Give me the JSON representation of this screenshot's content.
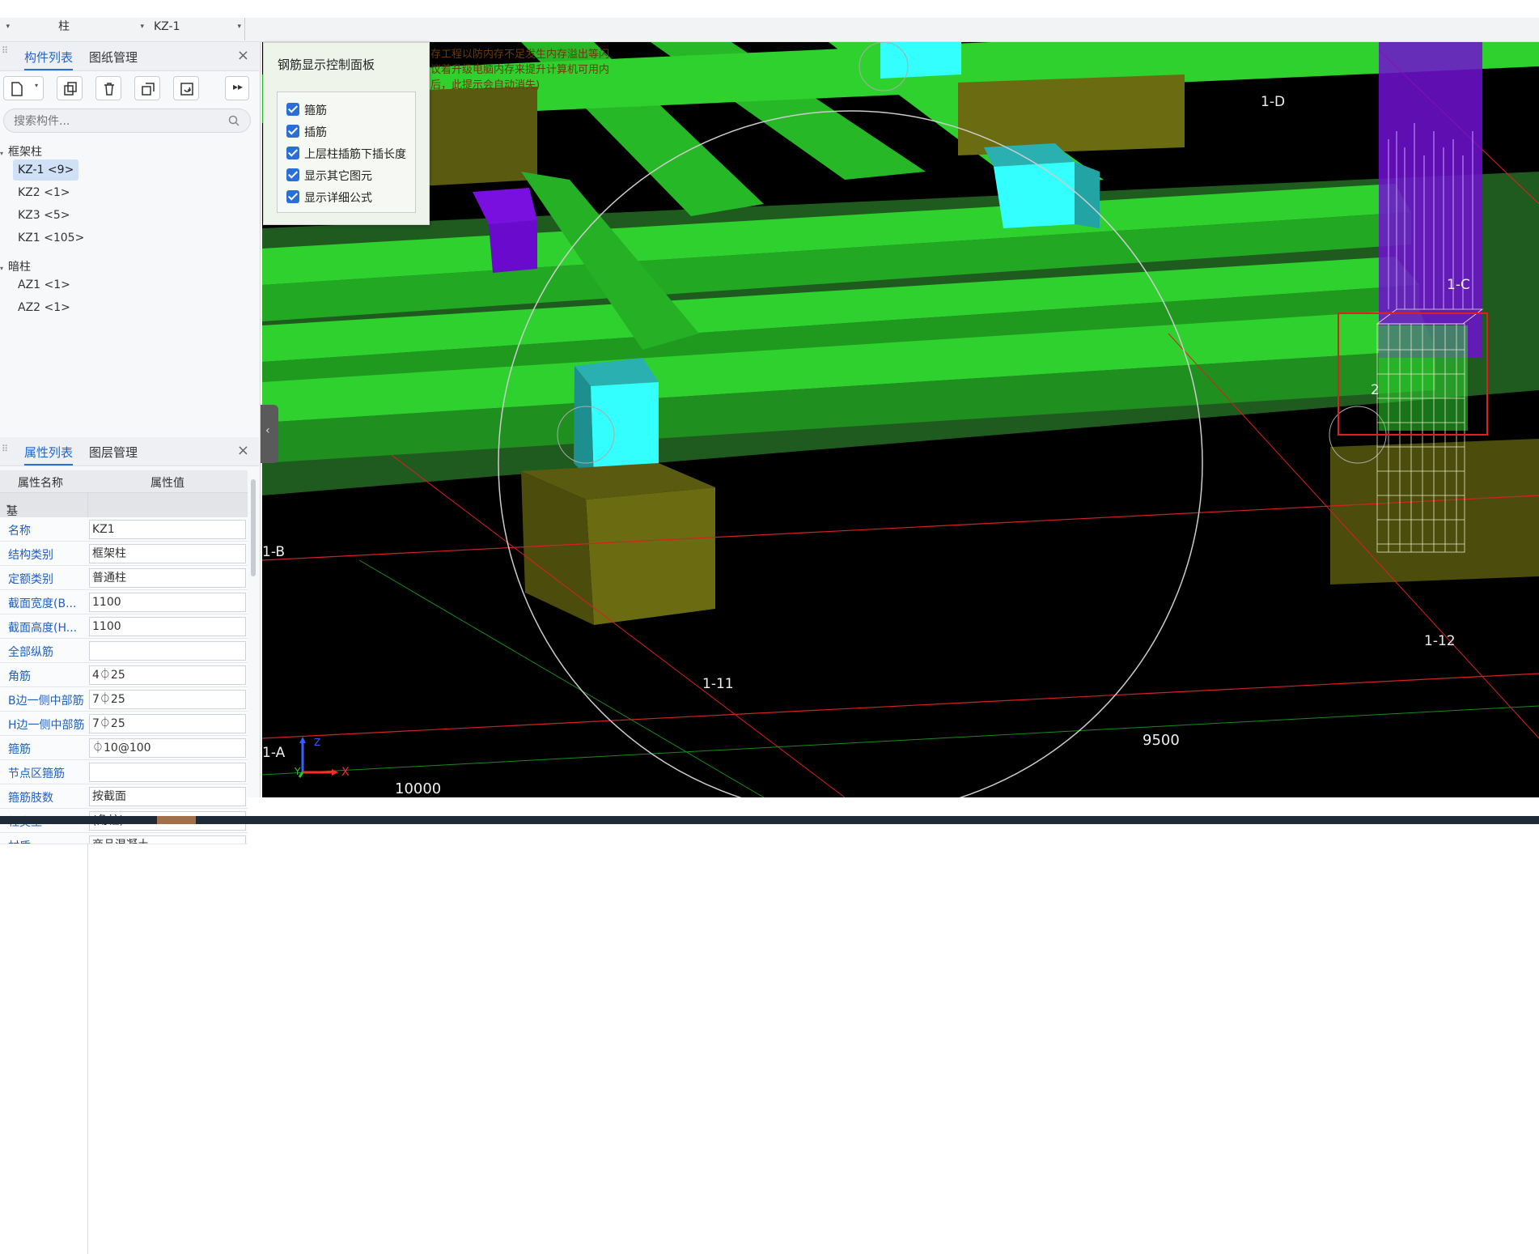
{
  "topbar": {
    "type_selector": {
      "value": "柱"
    },
    "component_selector": {
      "value": "KZ-1"
    }
  },
  "component_panel": {
    "tabs": [
      {
        "label": "构件列表"
      },
      {
        "label": "图纸管理"
      }
    ],
    "close_label": "×",
    "toolbar_icons": [
      "new-icon",
      "dropdown-caret-icon",
      "copy-icon",
      "delete-icon",
      "copy-to-floor-icon",
      "refresh-icon",
      "more-icon"
    ],
    "search": {
      "placeholder": "搜索构件..."
    },
    "groups": [
      {
        "label": "框架柱",
        "items": [
          {
            "label": "KZ-1 <9>",
            "selected": true
          },
          {
            "label": "KZ2 <1>"
          },
          {
            "label": "KZ3 <5>"
          },
          {
            "label": "KZ1 <105>"
          }
        ]
      },
      {
        "label": "暗柱",
        "items": [
          {
            "label": "AZ1 <1>"
          },
          {
            "label": "AZ2 <1>"
          }
        ]
      }
    ]
  },
  "property_panel": {
    "tabs": [
      {
        "label": "属性列表"
      },
      {
        "label": "图层管理"
      }
    ],
    "close_label": "×",
    "columns": {
      "name": "属性名称",
      "value": "属性值"
    },
    "section": "基础属性",
    "rows": [
      {
        "name": "名称",
        "value": "KZ1"
      },
      {
        "name": "结构类别",
        "value": "框架柱"
      },
      {
        "name": "定额类别",
        "value": "普通柱"
      },
      {
        "name": "截面宽度(B...",
        "value": "1100"
      },
      {
        "name": "截面高度(H...",
        "value": "1100"
      },
      {
        "name": "全部纵筋",
        "value": ""
      },
      {
        "name": "角筋",
        "value": "4⏀25"
      },
      {
        "name": "B边一侧中部筋",
        "value": "7⏀25"
      },
      {
        "name": "H边一侧中部筋",
        "value": "7⏀25"
      },
      {
        "name": "箍筋",
        "value": "⏀10@100"
      },
      {
        "name": "节点区箍筋",
        "value": ""
      },
      {
        "name": "箍筋肢数",
        "value": "按截面"
      },
      {
        "name": "柱类型",
        "value": "(角柱)"
      },
      {
        "name": "材质",
        "value": "商品混凝土"
      }
    ]
  },
  "rebar_control_panel": {
    "title": "钢筋显示控制面板",
    "options": [
      {
        "label": "箍筋",
        "checked": true
      },
      {
        "label": "插筋",
        "checked": true
      },
      {
        "label": "上层柱插筋下插长度",
        "checked": true
      },
      {
        "label": "显示其它图元",
        "checked": true
      },
      {
        "label": "显示详细公式",
        "checked": true
      }
    ]
  },
  "viewport": {
    "background": "#000000",
    "beam_color": "#2ed12e",
    "column_color": "#33ffff",
    "footing_color": "#6b6b12",
    "grid_labels": [
      "1-D",
      "1-C",
      "1-B",
      "1-A",
      "1-11",
      "1-12"
    ],
    "dimensions": [
      "10000",
      "9500"
    ],
    "axis_labels": {
      "x": "X",
      "y": "Y",
      "z": "Z"
    },
    "partial_overlay_text": [
      "存工程以防内存不足发生内存溢出等闪",
      "议着升级电脑内存来提升计算机可用内",
      "后，此提示会自动消失)"
    ],
    "partial_label": "2"
  }
}
